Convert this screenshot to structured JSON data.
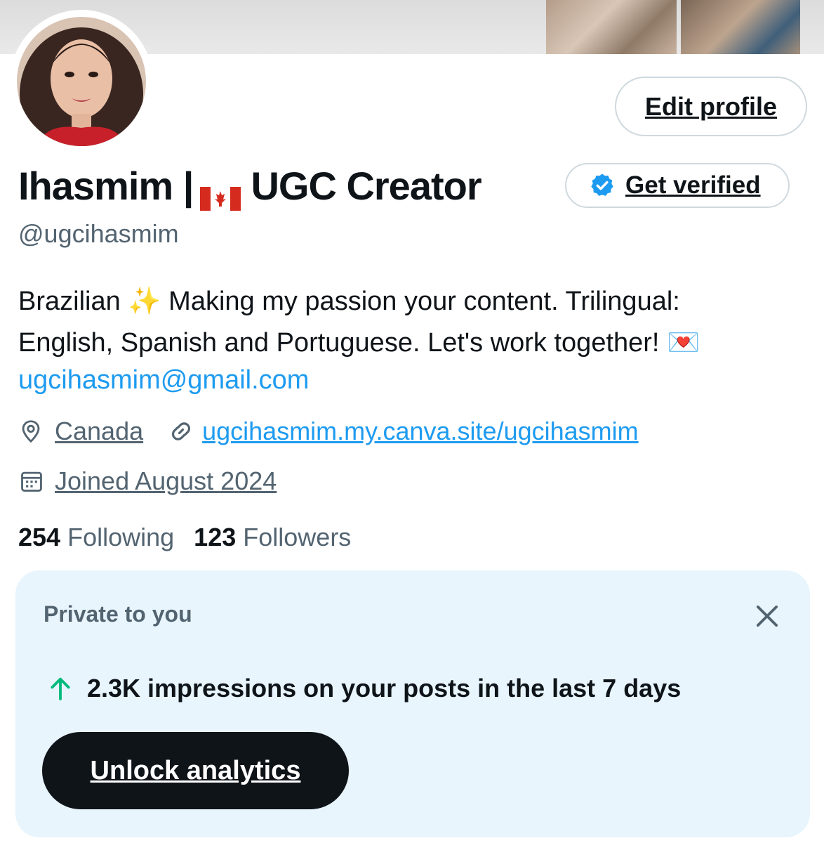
{
  "colors": {
    "accent": "#1d9bf0",
    "text_primary": "#0f1419",
    "text_secondary": "#536471",
    "card_bg": "#e8f5fd",
    "positive": "#00ba7c"
  },
  "header": {
    "edit_profile_label": "Edit profile"
  },
  "profile": {
    "name_part1": "Ihasmim |",
    "name_part2": "UGC Creator",
    "flag_icon": "canada-flag-icon",
    "get_verified_label": "Get verified",
    "verified_icon": "verified-badge-icon",
    "handle": "@ugcihasmim",
    "bio_line1": "Brazilian ✨ Making my passion your content. Trilingual:",
    "bio_line2": "English, Spanish and Portuguese. Let's work together! 💌",
    "email": "ugcihasmim@gmail.com",
    "location": "Canada",
    "location_icon": "location-pin-icon",
    "website": "ugcihasmim.my.canva.site/ugcihasmim",
    "website_icon": "link-icon",
    "joined": "Joined August 2024",
    "joined_icon": "calendar-icon"
  },
  "stats": {
    "following_count": "254",
    "following_label": "Following",
    "followers_count": "123",
    "followers_label": "Followers"
  },
  "private_card": {
    "title": "Private to you",
    "close_icon": "close-icon",
    "trend_icon": "arrow-up-icon",
    "impressions_text": "2.3K impressions on your posts in the last 7 days",
    "unlock_label": "Unlock analytics"
  }
}
